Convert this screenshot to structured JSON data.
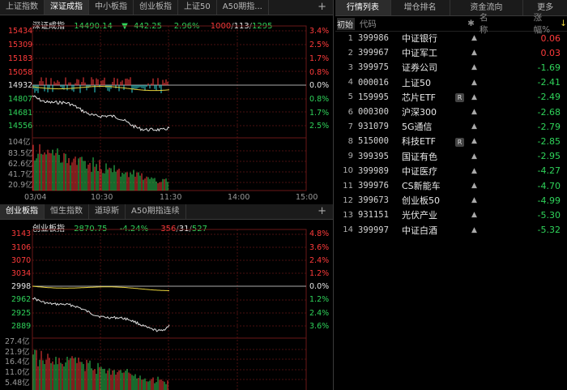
{
  "top_tabs": [
    "上证指数",
    "深证成指",
    "中小板指",
    "创业板指",
    "上证50",
    "A50期指..."
  ],
  "top_active": 1,
  "bottom_tabs": [
    "创业板指",
    "恒生指数",
    "道琼斯",
    "A50期指连续"
  ],
  "bottom_active": 0,
  "plus_icon": "+",
  "top_chart": {
    "name": "深证成指",
    "price": "14490.14",
    "arrow": "▼",
    "change": "442.25",
    "change_pct": "-2.96%",
    "breadth": {
      "up": "1000",
      "flat": "113",
      "down": "1295"
    },
    "y_labels_left": [
      "15434",
      "15309",
      "15183",
      "15058",
      "14932",
      "14807",
      "14681",
      "14556"
    ],
    "y_labels_right": [
      "3.4%",
      "2.5%",
      "1.7%",
      "0.8%",
      "0.0%",
      "0.8%",
      "1.7%",
      "2.5%"
    ],
    "vol_labels": [
      "104亿",
      "83.5亿",
      "62.6亿",
      "41.7亿",
      "20.9亿"
    ],
    "time_labels": [
      "03/04",
      "10:30",
      "11:30",
      "14:00",
      "15:00"
    ]
  },
  "bottom_chart": {
    "name": "创业板指",
    "price": "2870.75",
    "change_pct": "-4.24%",
    "breadth": {
      "up": "356",
      "flat": "31",
      "down": "527"
    },
    "y_labels_left": [
      "3143",
      "3106",
      "3070",
      "3034",
      "2998",
      "2962",
      "2925",
      "2889"
    ],
    "y_labels_right": [
      "4.8%",
      "3.6%",
      "2.4%",
      "1.2%",
      "0.0%",
      "1.2%",
      "2.4%",
      "3.6%"
    ],
    "vol_labels": [
      "27.4亿",
      "21.9亿",
      "16.4亿",
      "11.0亿",
      "5.48亿"
    ]
  },
  "right_tabs": [
    "行情列表",
    "增仓排名",
    "资金流向",
    "更多"
  ],
  "right_active": 0,
  "list_header": {
    "init": "初始",
    "code": "代码",
    "star": "✱",
    "name": "名称",
    "pct": "涨幅%",
    "sort_arrow": "↓"
  },
  "rows": [
    {
      "idx": "1",
      "code": "399986",
      "name": "中证银行",
      "r": false,
      "pct": "0.06",
      "dir": "up"
    },
    {
      "idx": "2",
      "code": "399967",
      "name": "中证军工",
      "r": false,
      "pct": "0.03",
      "dir": "up"
    },
    {
      "idx": "3",
      "code": "399975",
      "name": "证券公司",
      "r": false,
      "pct": "-1.69",
      "dir": "down"
    },
    {
      "idx": "4",
      "code": "000016",
      "name": "上证50",
      "r": false,
      "pct": "-2.41",
      "dir": "down"
    },
    {
      "idx": "5",
      "code": "159995",
      "name": "芯片ETF",
      "r": true,
      "pct": "-2.49",
      "dir": "down"
    },
    {
      "idx": "6",
      "code": "000300",
      "name": "沪深300",
      "r": false,
      "pct": "-2.68",
      "dir": "down"
    },
    {
      "idx": "7",
      "code": "931079",
      "name": "5G通信",
      "r": false,
      "pct": "-2.79",
      "dir": "down"
    },
    {
      "idx": "8",
      "code": "515000",
      "name": "科技ETF",
      "r": true,
      "pct": "-2.85",
      "dir": "down"
    },
    {
      "idx": "9",
      "code": "399395",
      "name": "国证有色",
      "r": false,
      "pct": "-2.95",
      "dir": "down"
    },
    {
      "idx": "10",
      "code": "399989",
      "name": "中证医疗",
      "r": false,
      "pct": "-4.27",
      "dir": "down"
    },
    {
      "idx": "11",
      "code": "399976",
      "name": "CS新能车",
      "r": false,
      "pct": "-4.70",
      "dir": "down"
    },
    {
      "idx": "12",
      "code": "399673",
      "name": "创业板50",
      "r": false,
      "pct": "-4.99",
      "dir": "down"
    },
    {
      "idx": "13",
      "code": "931151",
      "name": "光伏产业",
      "r": false,
      "pct": "-5.30",
      "dir": "down"
    },
    {
      "idx": "14",
      "code": "399997",
      "name": "中证白酒",
      "r": false,
      "pct": "-5.32",
      "dir": "down"
    }
  ],
  "r_badge": "R",
  "bell_icon": "▲",
  "colors": {
    "up": "#ff3b3b",
    "down": "#2fd35a",
    "avg": "#e8d23c",
    "price": "#e0e0e0"
  }
}
